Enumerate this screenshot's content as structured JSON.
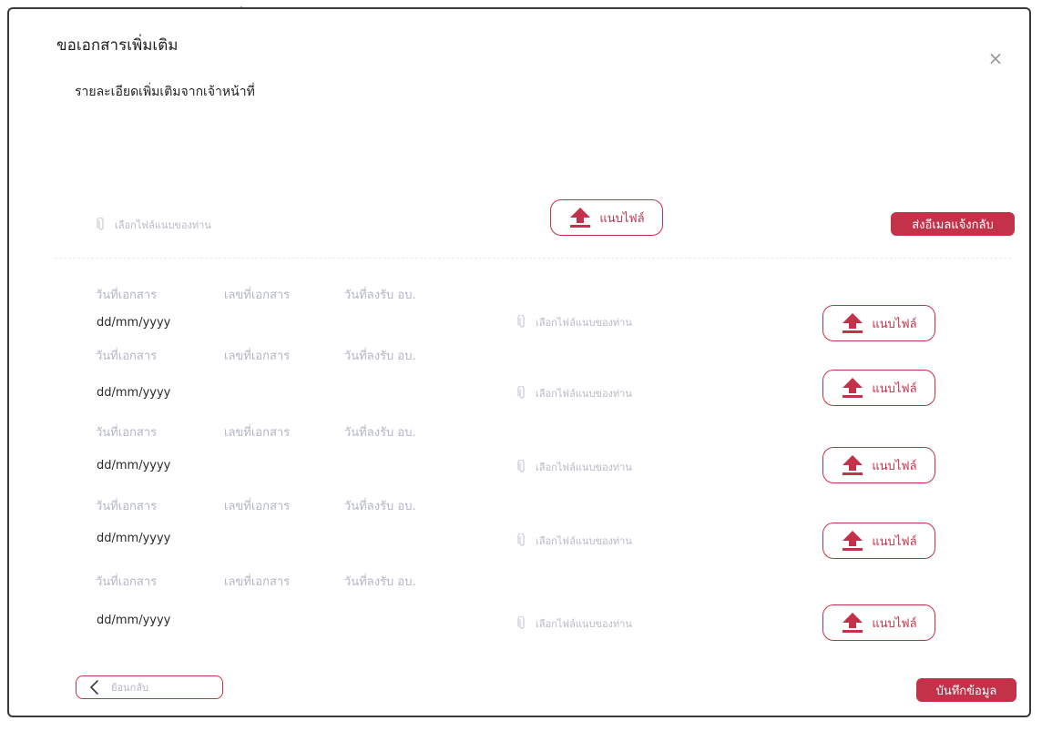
{
  "modal": {
    "title": "ขอเอกสารเพิ่มเติม",
    "close_symbol": "×",
    "subtitle": "รายละเอียดเพิ่มเติมจากเจ้าหน้าที่"
  },
  "top_upload": {
    "file_placeholder": "เลือกไฟล์แนบของท่าน",
    "upload_label": "แนบไฟล์",
    "send_email_label": "ส่งอีเมลแจ้งกลับ"
  },
  "columns": {
    "doc_date": "วันที่เอกสาร",
    "doc_number": "เลขที่เอกสาร",
    "received_date": "วันที่ลงรับ อบ."
  },
  "rows": [
    {
      "date_placeholder": "dd/mm/yyyy",
      "file_placeholder": "เลือกไฟล์แนบของท่าน",
      "upload_label": "แนบไฟล์"
    },
    {
      "date_placeholder": "dd/mm/yyyy",
      "file_placeholder": "เลือกไฟล์แนบของท่าน",
      "upload_label": "แนบไฟล์"
    },
    {
      "date_placeholder": "dd/mm/yyyy",
      "file_placeholder": "เลือกไฟล์แนบของท่าน",
      "upload_label": "แนบไฟล์"
    },
    {
      "date_placeholder": "dd/mm/yyyy",
      "file_placeholder": "เลือกไฟล์แนบของท่าน",
      "upload_label": "แนบไฟล์"
    },
    {
      "date_placeholder": "dd/mm/yyyy",
      "file_placeholder": "เลือกไฟล์แนบของท่าน",
      "upload_label": "แนบไฟล์"
    }
  ],
  "footer": {
    "back_label": "ย้อนกลับ",
    "save_label": "บันทึกข้อมูล"
  },
  "icons": {
    "paperclip": "paperclip-icon",
    "upload": "upload-arrow-icon",
    "back": "chevron-left-icon",
    "close": "close-icon"
  },
  "colors": {
    "accent": "#c4324a",
    "muted_text": "#b3b5c8",
    "border": "#3a3a3a"
  }
}
